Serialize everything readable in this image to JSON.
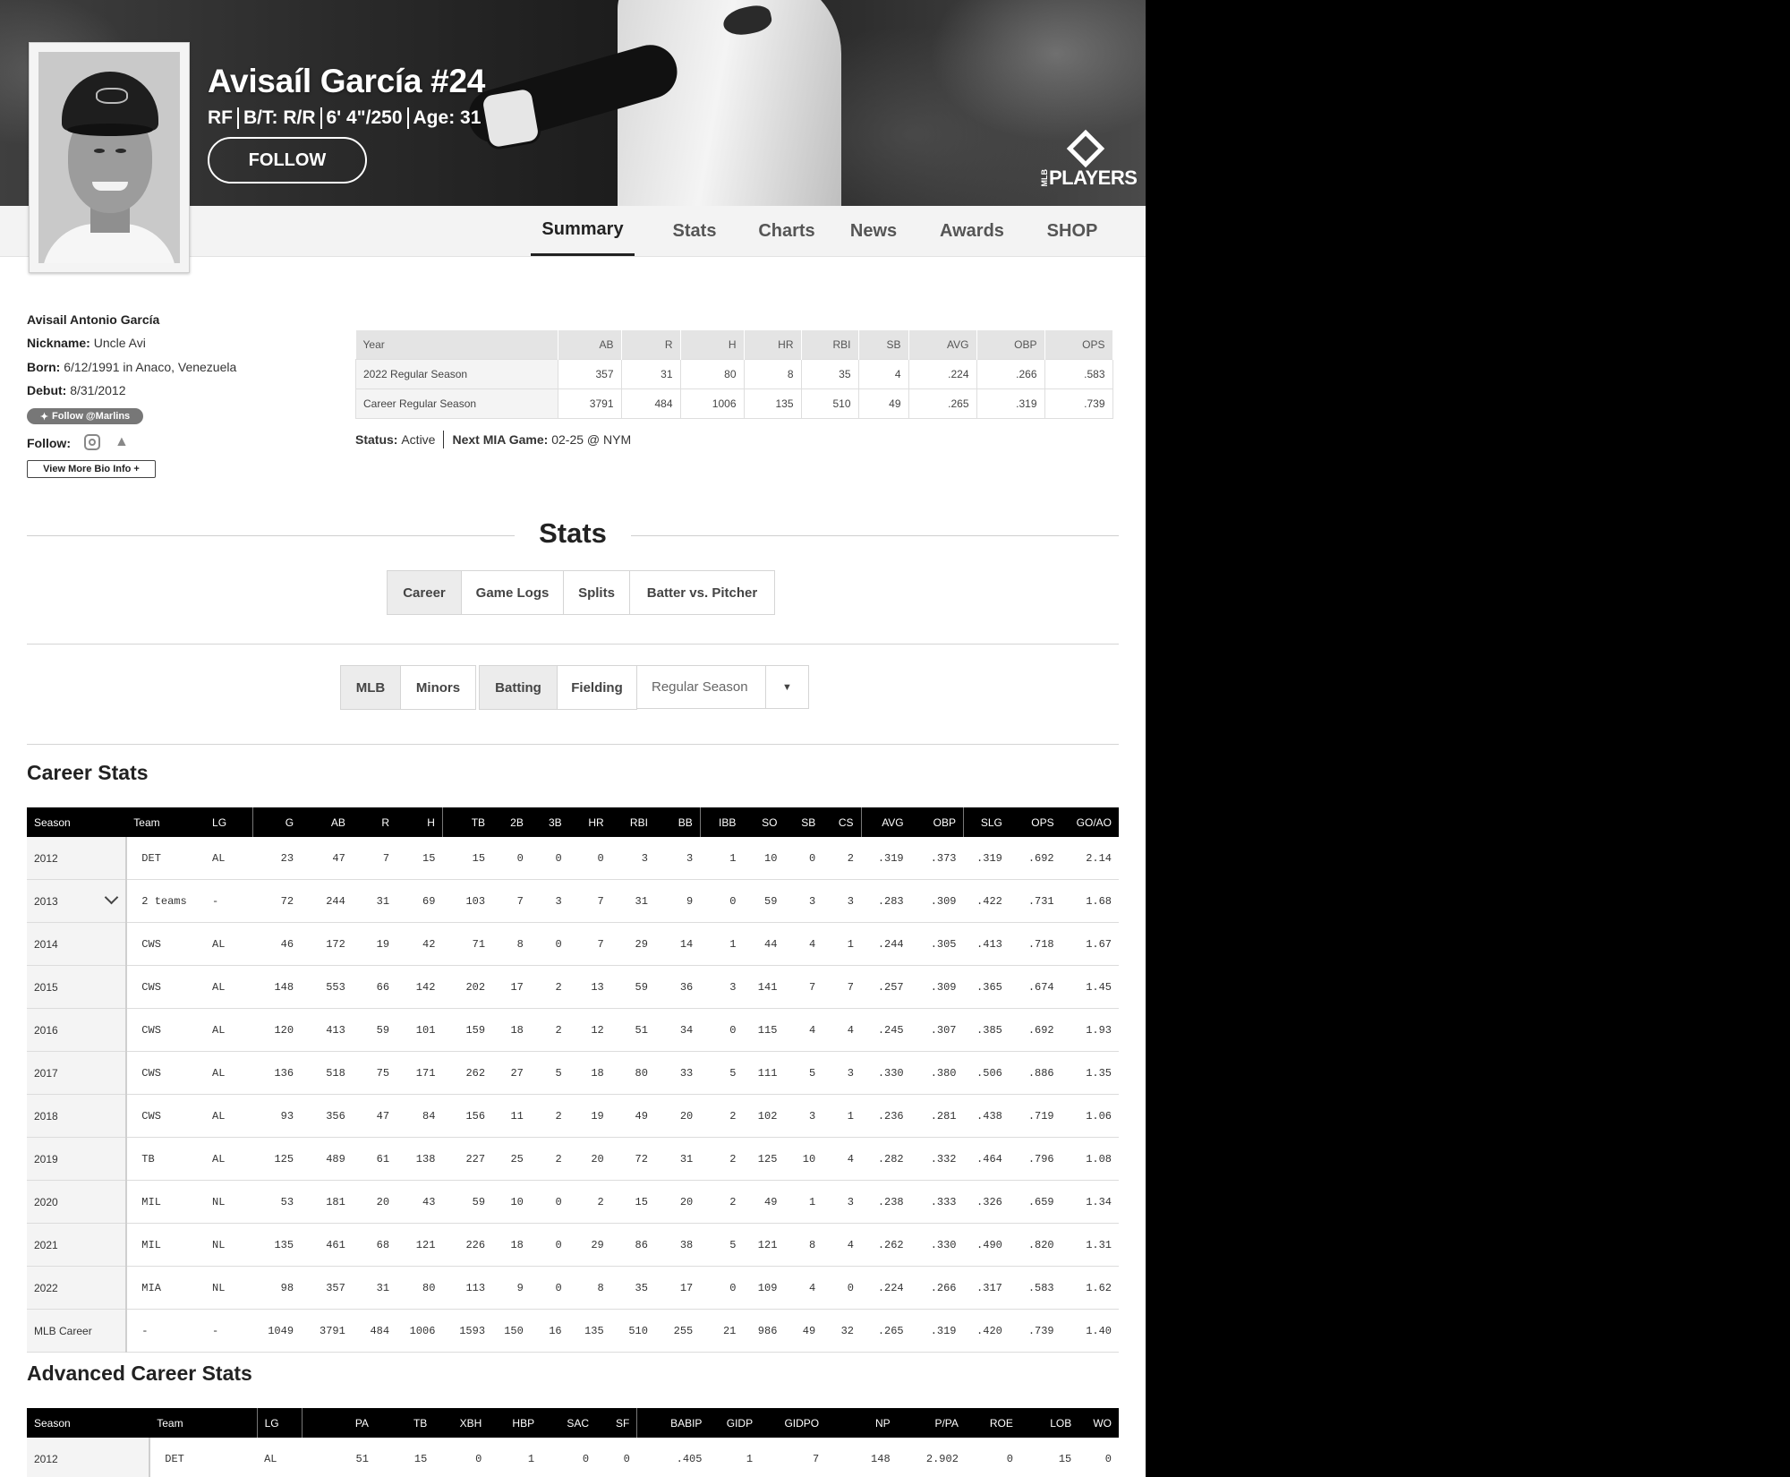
{
  "hero": {
    "name": "Avisaíl García #24",
    "position": "RF",
    "bats_throws": "B/T: R/R",
    "height_weight": "6' 4\"/250",
    "age": "Age: 31",
    "follow_label": "FOLLOW",
    "logo_small": "MLB",
    "logo_word": "PLAYERS"
  },
  "nav": {
    "tabs": [
      "Summary",
      "Stats",
      "Charts",
      "News",
      "Awards",
      "SHOP"
    ],
    "active": "Summary"
  },
  "bio": {
    "full_name": "Avisail Antonio García",
    "nickname_label": "Nickname:",
    "nickname": "Uncle Avi",
    "born_label": "Born:",
    "born": "6/12/1991 in Anaco, Venezuela",
    "debut_label": "Debut:",
    "debut": "8/31/2012",
    "twitter_follow": "Follow @Marlins",
    "follow_label": "Follow:",
    "view_more": "View More Bio Info +"
  },
  "summary": {
    "headers": [
      "Year",
      "AB",
      "R",
      "H",
      "HR",
      "RBI",
      "SB",
      "AVG",
      "OBP",
      "OPS"
    ],
    "rows": [
      [
        "2022 Regular Season",
        "357",
        "31",
        "80",
        "8",
        "35",
        "4",
        ".224",
        ".266",
        ".583"
      ],
      [
        "Career Regular Season",
        "3791",
        "484",
        "1006",
        "135",
        "510",
        "49",
        ".265",
        ".319",
        ".739"
      ]
    ],
    "status_label": "Status:",
    "status": "Active",
    "next_game_label": "Next MIA Game:",
    "next_game": "02-25 @ NYM"
  },
  "stats_section": {
    "title": "Stats",
    "view_tabs": [
      "Career",
      "Game Logs",
      "Splits",
      "Batter vs. Pitcher"
    ],
    "view_active": "Career",
    "level_tabs": [
      "MLB",
      "Minors"
    ],
    "level_active": "MLB",
    "type_tabs": [
      "Batting",
      "Fielding"
    ],
    "type_active": "Batting",
    "season_select": "Regular Season"
  },
  "career": {
    "title": "Career Stats",
    "headers": [
      "Season",
      "Team",
      "LG",
      "G",
      "AB",
      "R",
      "H",
      "TB",
      "2B",
      "3B",
      "HR",
      "RBI",
      "BB",
      "IBB",
      "SO",
      "SB",
      "CS",
      "AVG",
      "OBP",
      "SLG",
      "OPS",
      "GO/AO"
    ],
    "rows": [
      [
        "2012",
        "DET",
        "AL",
        "23",
        "47",
        "7",
        "15",
        "15",
        "0",
        "0",
        "0",
        "3",
        "3",
        "1",
        "10",
        "0",
        "2",
        ".319",
        ".373",
        ".319",
        ".692",
        "2.14"
      ],
      [
        "2013",
        "2 teams",
        "-",
        "72",
        "244",
        "31",
        "69",
        "103",
        "7",
        "3",
        "7",
        "31",
        "9",
        "0",
        "59",
        "3",
        "3",
        ".283",
        ".309",
        ".422",
        ".731",
        "1.68"
      ],
      [
        "2014",
        "CWS",
        "AL",
        "46",
        "172",
        "19",
        "42",
        "71",
        "8",
        "0",
        "7",
        "29",
        "14",
        "1",
        "44",
        "4",
        "1",
        ".244",
        ".305",
        ".413",
        ".718",
        "1.67"
      ],
      [
        "2015",
        "CWS",
        "AL",
        "148",
        "553",
        "66",
        "142",
        "202",
        "17",
        "2",
        "13",
        "59",
        "36",
        "3",
        "141",
        "7",
        "7",
        ".257",
        ".309",
        ".365",
        ".674",
        "1.45"
      ],
      [
        "2016",
        "CWS",
        "AL",
        "120",
        "413",
        "59",
        "101",
        "159",
        "18",
        "2",
        "12",
        "51",
        "34",
        "0",
        "115",
        "4",
        "4",
        ".245",
        ".307",
        ".385",
        ".692",
        "1.93"
      ],
      [
        "2017",
        "CWS",
        "AL",
        "136",
        "518",
        "75",
        "171",
        "262",
        "27",
        "5",
        "18",
        "80",
        "33",
        "5",
        "111",
        "5",
        "3",
        ".330",
        ".380",
        ".506",
        ".886",
        "1.35"
      ],
      [
        "2018",
        "CWS",
        "AL",
        "93",
        "356",
        "47",
        "84",
        "156",
        "11",
        "2",
        "19",
        "49",
        "20",
        "2",
        "102",
        "3",
        "1",
        ".236",
        ".281",
        ".438",
        ".719",
        "1.06"
      ],
      [
        "2019",
        "TB",
        "AL",
        "125",
        "489",
        "61",
        "138",
        "227",
        "25",
        "2",
        "20",
        "72",
        "31",
        "2",
        "125",
        "10",
        "4",
        ".282",
        ".332",
        ".464",
        ".796",
        "1.08"
      ],
      [
        "2020",
        "MIL",
        "NL",
        "53",
        "181",
        "20",
        "43",
        "59",
        "10",
        "0",
        "2",
        "15",
        "20",
        "2",
        "49",
        "1",
        "3",
        ".238",
        ".333",
        ".326",
        ".659",
        "1.34"
      ],
      [
        "2021",
        "MIL",
        "NL",
        "135",
        "461",
        "68",
        "121",
        "226",
        "18",
        "0",
        "29",
        "86",
        "38",
        "5",
        "121",
        "8",
        "4",
        ".262",
        ".330",
        ".490",
        ".820",
        "1.31"
      ],
      [
        "2022",
        "MIA",
        "NL",
        "98",
        "357",
        "31",
        "80",
        "113",
        "9",
        "0",
        "8",
        "35",
        "17",
        "0",
        "109",
        "4",
        "0",
        ".224",
        ".266",
        ".317",
        ".583",
        "1.62"
      ],
      [
        "MLB Career",
        "-",
        "-",
        "1049",
        "3791",
        "484",
        "1006",
        "1593",
        "150",
        "16",
        "135",
        "510",
        "255",
        "21",
        "986",
        "49",
        "32",
        ".265",
        ".319",
        ".420",
        ".739",
        "1.40"
      ]
    ]
  },
  "advanced": {
    "title": "Advanced Career Stats",
    "headers": [
      "Season",
      "Team",
      "LG",
      "PA",
      "TB",
      "XBH",
      "HBP",
      "SAC",
      "SF",
      "BABIP",
      "GIDP",
      "GIDPO",
      "NP",
      "P/PA",
      "ROE",
      "LOB",
      "WO"
    ],
    "rows": [
      [
        "2012",
        "DET",
        "AL",
        "51",
        "15",
        "0",
        "1",
        "0",
        "0",
        ".405",
        "1",
        "7",
        "148",
        "2.902",
        "0",
        "15",
        "0"
      ]
    ]
  }
}
